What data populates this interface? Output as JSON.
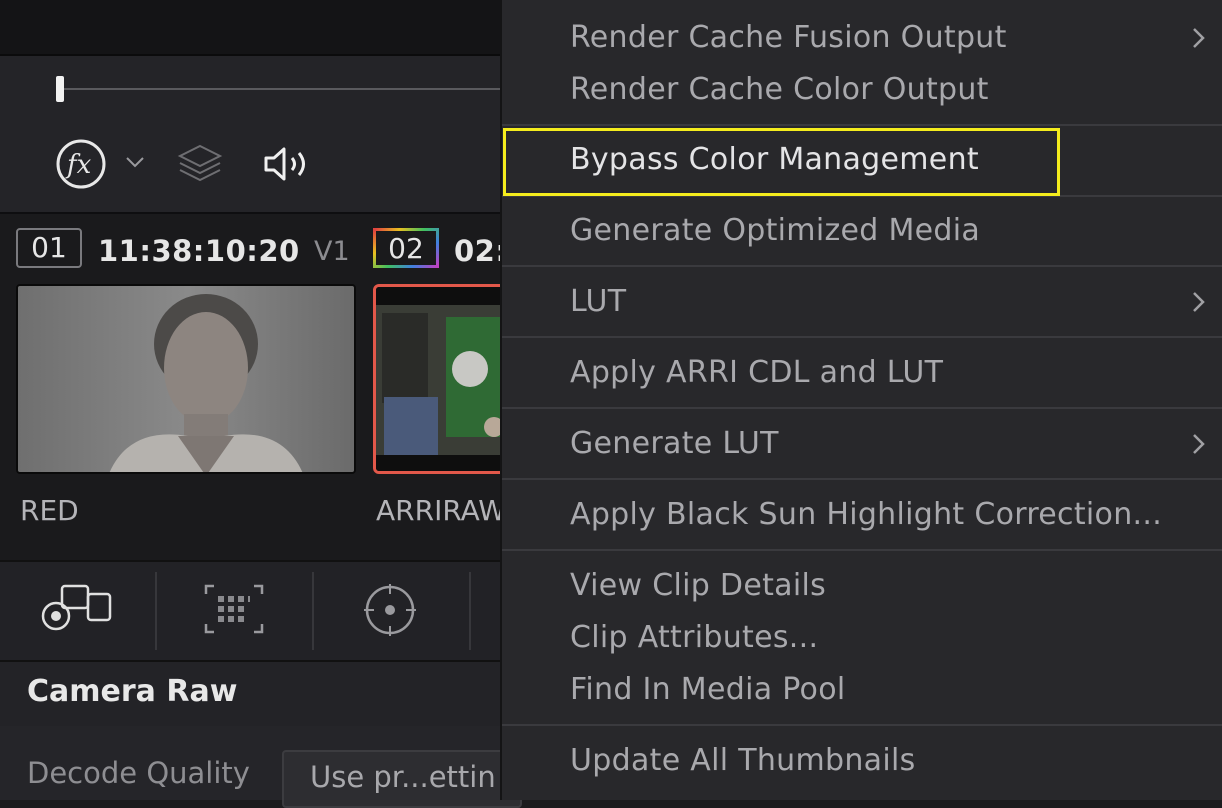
{
  "viewer": {
    "fx_icon": "fx-icon",
    "dropdown_icon": "chevron-down-icon",
    "layers_icon": "layers-icon",
    "audio_icon": "speaker-icon"
  },
  "clips": [
    {
      "number": "01",
      "timecode": "11:38:10:20",
      "track": "V1",
      "label": "RED"
    },
    {
      "number": "02",
      "timecode": "02:",
      "label": "ARRIRAW"
    }
  ],
  "toolbar": {
    "icons": [
      "camera-raw-icon",
      "color-match-icon",
      "color-wheels-icon"
    ]
  },
  "camera_raw": {
    "title": "Camera Raw",
    "decode_quality_label": "Decode Quality",
    "decode_quality_value": "Use pr...ettin"
  },
  "context_menu": {
    "items": [
      {
        "label": "Render Cache Fusion Output",
        "submenu": true
      },
      {
        "label": "Render Cache Color Output"
      },
      {
        "label": "Bypass Color Management",
        "highlighted": true
      },
      {
        "label": "Generate Optimized Media"
      },
      {
        "label": "LUT",
        "submenu": true
      },
      {
        "label": "Apply ARRI CDL and LUT"
      },
      {
        "label": "Generate LUT",
        "submenu": true
      },
      {
        "label": "Apply Black Sun Highlight Correction..."
      },
      {
        "label": "View Clip Details"
      },
      {
        "label": "Clip Attributes..."
      },
      {
        "label": "Find In Media Pool"
      },
      {
        "label": "Update All Thumbnails"
      }
    ],
    "highlight_color": "#f4ec1d"
  }
}
